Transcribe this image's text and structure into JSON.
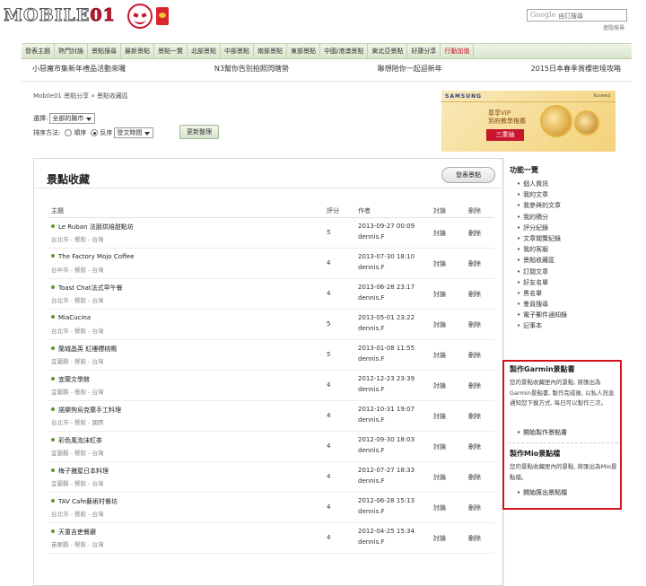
{
  "header": {
    "logo_text": "MOBILE01",
    "search_placeholder": "自訂搜尋",
    "search_brand": "Google",
    "search_help": "進階搜尋"
  },
  "nav": [
    "發表主題",
    "熱門討論",
    "景點搜尋",
    "最新景點",
    "景點一覽",
    "北部景點",
    "中部景點",
    "南部景點",
    "東部景點",
    "中國/港澳景點",
    "東北亞景點",
    "好康分享",
    "行動加值"
  ],
  "promo": [
    "小惡魔市集新年禮品活動來囉",
    "N3幫你告別拍照閃瞎勢",
    "聯想陪你一起迎新年",
    "2015日本春季賞櫻密境攻略"
  ],
  "breadcrumb": "Mobile01 景點分享 » 景點收藏區",
  "filter": {
    "select_label": "選擇:",
    "select_value": "全部的縣市",
    "sort_label": "排序方法:",
    "asc_label": "順序",
    "desc_label": "反序",
    "sort_value": "發文時間",
    "update_button": "更新整理"
  },
  "ad": {
    "brand": "SAMSUNG",
    "brand2": "Kurwed",
    "line1": "尊享VIP",
    "line2": "到府教學推薦",
    "draw": "三重抽"
  },
  "panel": {
    "title": "景點收藏",
    "post_button": "發表景點",
    "headers": {
      "title": "主題",
      "score": "評分",
      "author": "作者",
      "discuss": "討論",
      "delete": "刪除"
    },
    "rows": [
      {
        "title": "Le Ruban 法朋烘焙甜點坊",
        "meta": "台北市 - 餐飲 - 台灣",
        "score": "5",
        "date": "2013-09-27 00:09",
        "author": "dennis.F",
        "discuss": "討論",
        "delete": "刪除"
      },
      {
        "title": "The Factory Mojo Coffee",
        "meta": "台中市 - 餐飲 - 台灣",
        "score": "4",
        "date": "2013-07-30 18:10",
        "author": "dennis.F",
        "discuss": "討論",
        "delete": "刪除"
      },
      {
        "title": "Toast Chat法式早午餐",
        "meta": "台北市 - 餐飲 - 台灣",
        "score": "4",
        "date": "2013-06-28 23:17",
        "author": "dennis.F",
        "discuss": "討論",
        "delete": "刪除"
      },
      {
        "title": "MiaCucina",
        "meta": "台北市 - 餐飲 - 台灣",
        "score": "5",
        "date": "2013-05-01 23:22",
        "author": "dennis.F",
        "discuss": "討論",
        "delete": "刪除"
      },
      {
        "title": "蘭城晶英 紅樓櫻桃鴨",
        "meta": "宜蘭縣 - 餐飲 - 台灣",
        "score": "5",
        "date": "2013-01-08 11:55",
        "author": "dennis.F",
        "discuss": "討論",
        "delete": "刪除"
      },
      {
        "title": "宜蘭文學館",
        "meta": "宜蘭縣 - 餐飲 - 台灣",
        "score": "4",
        "date": "2012-12-23 23:39",
        "author": "dennis.F",
        "discuss": "討論",
        "delete": "刪除"
      },
      {
        "title": "諾樂狗烏克蘭手工料理",
        "meta": "台北市 - 餐飲 - 國際",
        "score": "4",
        "date": "2012-10-31 19:07",
        "author": "dennis.F",
        "discuss": "討論",
        "delete": "刪除"
      },
      {
        "title": "彩色風泡沫紅茶",
        "meta": "宜蘭縣 - 餐飲 - 台灣",
        "score": "4",
        "date": "2012-09-30 18:03",
        "author": "dennis.F",
        "discuss": "討論",
        "delete": "刪除"
      },
      {
        "title": "梅子饅屋日本料理",
        "meta": "宜蘭縣 - 餐飲 - 台灣",
        "score": "4",
        "date": "2012-07-27 18:33",
        "author": "dennis.F",
        "discuss": "討論",
        "delete": "刪除"
      },
      {
        "title": "TAV Cafe藝術村餐坊",
        "meta": "台北市 - 餐飲 - 台灣",
        "score": "4",
        "date": "2012-06-28 15:13",
        "author": "dennis.F",
        "discuss": "討論",
        "delete": "刪除"
      },
      {
        "title": "天童吉吏餐廳",
        "meta": "苗栗縣 - 餐飲 - 台灣",
        "score": "4",
        "date": "2012-04-25 15:34",
        "author": "dennis.F",
        "discuss": "討論",
        "delete": "刪除"
      }
    ]
  },
  "sidebar": {
    "title": "功能一覽",
    "items": [
      "個人資訊",
      "我的文章",
      "我參與的文章",
      "我的積分",
      "評分紀錄",
      "文章閱覽紀錄",
      "我的客服",
      "景點收藏區",
      "訂閱文章",
      "好友名單",
      "黑名單",
      "會員搜尋",
      "電子郵件通知錄",
      "記事本"
    ],
    "garmin": {
      "title": "製作Garmin景點書",
      "desc": "您的景點收藏匣內的景點, 將匯出為Garmin景點書, 製作完成後, 以私人訊息通知您下載方式, 每日可以製作三次。",
      "link": "開始製作景點書"
    },
    "mio": {
      "title": "製作Mio景點檔",
      "desc": "您的景點收藏匣內的景點, 將匯出為Mio景點檔。",
      "link": "開始匯出景點檔"
    }
  },
  "colors": {
    "nav_bg": "#d9e5cc",
    "highlight_box": "#d0121b",
    "accent_red": "#c8162d"
  }
}
